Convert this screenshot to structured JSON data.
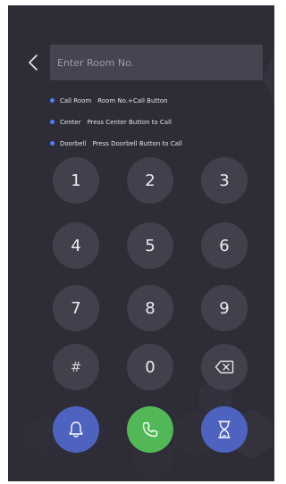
{
  "search": {
    "placeholder": "Enter Room No.",
    "value": ""
  },
  "hints": [
    {
      "title": "Call Room",
      "text": "Room No.+Call Button"
    },
    {
      "title": "Center",
      "text": "Press Center Button to Call"
    },
    {
      "title": "Doorbell",
      "text": "Press Doorbell Button to Call"
    }
  ],
  "keypad": {
    "keys": [
      "1",
      "2",
      "3",
      "4",
      "5",
      "6",
      "7",
      "8",
      "9",
      "#",
      "0"
    ]
  },
  "colors": {
    "background": "#2d2c37",
    "key": "#41404c",
    "input": "#454451",
    "hint_dot": "#4e7ff0",
    "doorbell_button": "#4e62c0",
    "call_button": "#52b857",
    "center_button": "#4e62c0"
  },
  "icons": {
    "back": "chevron-left-icon",
    "backspace": "backspace-icon",
    "doorbell": "bell-icon",
    "call": "phone-icon",
    "center": "hourglass-icon"
  }
}
